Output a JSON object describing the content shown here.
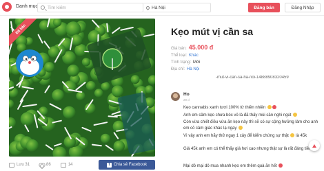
{
  "header": {
    "category_label": "Danh mục",
    "search_placeholder": "Tìm kiếm",
    "location": "Hà Nội",
    "post_label": "Đăng bán",
    "login_label": "Đăng Nhập"
  },
  "image": {
    "badge": "Đã bán"
  },
  "actions": {
    "views": "Lưu 31",
    "likes": "86",
    "comments": "14",
    "share_label": "Chia sẻ Facebook"
  },
  "product": {
    "title": "Kẹo mút vị cần sa",
    "price_label": "Giá bán:",
    "price": "45.000 đ",
    "category_label": "Thể loại:",
    "category": "Khác",
    "condition_label": "Tình trạng:",
    "condition": "Mới",
    "area_label": "Địa chỉ:",
    "area": "Hà Nội",
    "url": "-mut-vi-can-sa-ha-noi-14888908320459"
  },
  "comment": {
    "name": "Ho",
    "time": "29 d",
    "lines": [
      "Kẹo cannabis xanh tươi 100% từ thiên nhiên",
      "Anh em cầm kẹo chưa bóc vỏ là đã thấy mùi cần nghi ngút",
      "Còn vừa chiết điều vừa ăn kẹo này thì sẽ có sự cộng hưởng làm cho anh",
      "em cỏ cảm giác khác lạ ngay",
      "Vì vậy anh em hãy thử ngay 1 cây để kiểm chứng sự thật",
      "Giá 45k anh em có thể thấy giá hơi cao nhưng thật sự là rất đáng tiền",
      "Mại dô mại dô mua nhanh kẹo em thêm quà ăn hết"
    ],
    "line_extra": "là 45k"
  }
}
